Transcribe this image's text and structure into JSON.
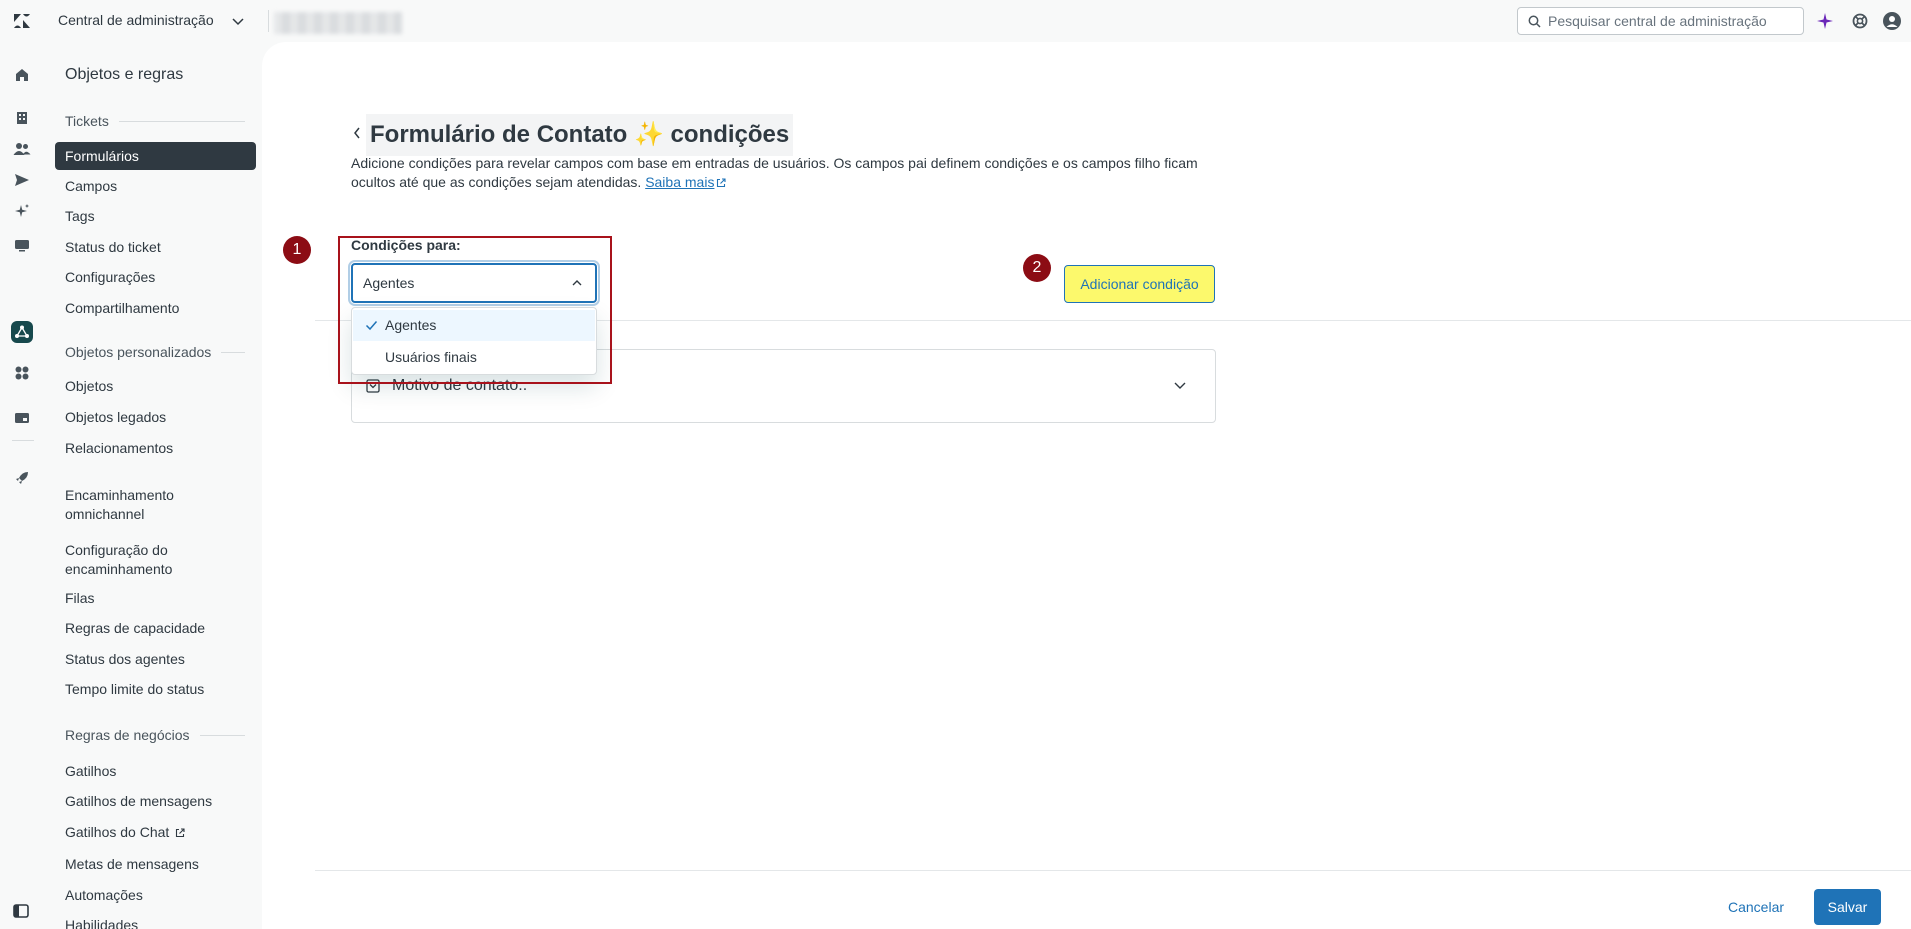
{
  "header": {
    "app_title": "Central de administração",
    "search_placeholder": "Pesquisar central de administração"
  },
  "nav": {
    "title": "Objetos e regras",
    "sections": [
      {
        "label": "Tickets",
        "items": [
          "Formulários",
          "Campos",
          "Tags",
          "Status do ticket",
          "Configurações",
          "Compartilhamento"
        ]
      },
      {
        "label": "Objetos personalizados",
        "items": [
          "Objetos",
          "Objetos legados",
          "Relacionamentos"
        ]
      },
      {
        "label": "Encaminhamento omnichannel",
        "items": [
          "Configuração do encaminhamento",
          "Filas",
          "Regras de capacidade",
          "Status dos agentes",
          "Tempo limite do status"
        ]
      },
      {
        "label": "Regras de negócios",
        "items": [
          "Gatilhos",
          "Gatilhos de mensagens",
          "Gatilhos do Chat",
          "Metas de mensagens",
          "Automações",
          "Habilidades"
        ]
      }
    ],
    "selected_item": "Formulários"
  },
  "page": {
    "title": "Formulário de Contato ✨ condições",
    "description": "Adicione condições para revelar campos com base em entradas de usuários. Os campos pai definem condições e os campos filho ficam ocultos até que as condições sejam atendidas.",
    "learn_more": "Saiba mais",
    "conditions_label": "Condições para:",
    "select_value": "Agentes",
    "dropdown_options": [
      "Agentes",
      "Usuários finais"
    ],
    "add_condition_label": "Adicionar condição",
    "field_label": "Motivo de contato..",
    "badge_1": "1",
    "badge_2": "2",
    "cancel_label": "Cancelar",
    "save_label": "Salvar"
  },
  "colors": {
    "accent": "#1f73b7",
    "highlight_yellow": "#fcf96c",
    "annotation_red": "#a8121b",
    "selected_nav": "#2f3941"
  }
}
